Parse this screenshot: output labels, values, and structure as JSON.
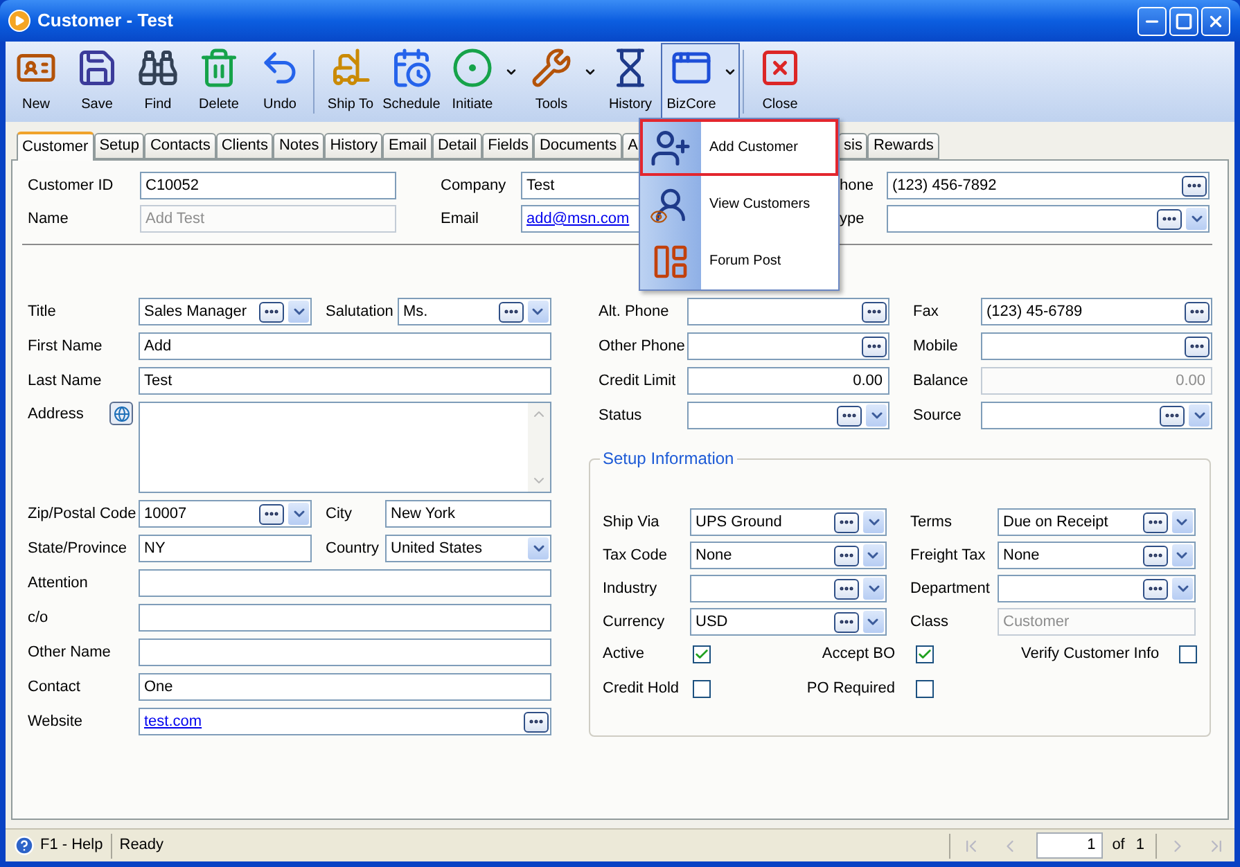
{
  "window": {
    "title": "Customer - Test"
  },
  "toolbar": {
    "groups": [
      {
        "items": [
          {
            "label": "New",
            "kind": "button",
            "pressed": false
          },
          {
            "label": "Save",
            "kind": "button",
            "pressed": false
          },
          {
            "label": "Find",
            "kind": "button",
            "pressed": false
          },
          {
            "label": "Delete",
            "kind": "button",
            "pressed": false
          },
          {
            "label": "Undo",
            "kind": "button",
            "pressed": false
          }
        ]
      },
      {
        "items": [
          {
            "label": "Ship To",
            "kind": "button",
            "pressed": false
          },
          {
            "label": "Schedule",
            "kind": "button",
            "pressed": false
          },
          {
            "label": "Initiate",
            "kind": "split",
            "pressed": false
          },
          {
            "label": "Tools",
            "kind": "split",
            "pressed": false
          },
          {
            "label": "History",
            "kind": "button",
            "pressed": false
          },
          {
            "label": "BizCore",
            "kind": "split",
            "pressed": true
          }
        ]
      },
      {
        "items": [
          {
            "label": "Close",
            "kind": "button",
            "pressed": false
          }
        ]
      }
    ]
  },
  "tabs": [
    {
      "label": "Customer",
      "selected": true
    },
    {
      "label": "Setup",
      "selected": false
    },
    {
      "label": "Contacts",
      "selected": false
    },
    {
      "label": "Clients",
      "selected": false
    },
    {
      "label": "Notes",
      "selected": false
    },
    {
      "label": "History",
      "selected": false
    },
    {
      "label": "Email",
      "selected": false
    },
    {
      "label": "Detail",
      "selected": false
    },
    {
      "label": "Fields",
      "selected": false
    },
    {
      "label": "Documents",
      "selected": false
    },
    {
      "label": "A",
      "selected": false
    },
    {
      "label": "sis",
      "selected": false
    },
    {
      "label": "Rewards",
      "selected": false
    }
  ],
  "menu": {
    "items": [
      {
        "label": "Add Customer",
        "selected": true
      },
      {
        "label": "View Customers",
        "selected": false
      },
      {
        "label": "Forum Post",
        "selected": false
      }
    ]
  },
  "header": {
    "rows": [
      [
        {
          "label": "Customer ID",
          "value": "C10052",
          "kind": "text",
          "disabled": false
        },
        {
          "label": "Company",
          "value": "Test",
          "kind": "text",
          "disabled": false
        },
        {
          "label": "hone",
          "value": "(123) 456-7892",
          "kind": "lookup",
          "disabled": false
        }
      ],
      [
        {
          "label": "Name",
          "value": "Add Test",
          "kind": "text",
          "disabled": true
        },
        {
          "label": "Email",
          "value": "add@msn.com",
          "kind": "link",
          "disabled": false
        },
        {
          "label": "ype",
          "kind": "combo",
          "disabled": false
        }
      ]
    ]
  },
  "contact": {
    "rows": [
      [
        {
          "label": "Title",
          "value": "Sales Manager",
          "kind": "combo",
          "disabled": false
        },
        {
          "label": "Salutation",
          "value": "Ms.",
          "kind": "combo",
          "disabled": false
        }
      ],
      [
        {
          "label": "First Name",
          "value": "Add",
          "kind": "text",
          "disabled": false
        }
      ],
      [
        {
          "label": "Last Name",
          "value": "Test",
          "kind": "text",
          "disabled": false
        }
      ],
      [
        {
          "label": "Address",
          "kind": "memo",
          "disabled": false
        }
      ],
      [
        {
          "label": "Zip/Postal Code",
          "value": "10007",
          "kind": "combo",
          "disabled": false
        },
        {
          "label": "City",
          "value": "New York",
          "kind": "text",
          "disabled": false
        }
      ],
      [
        {
          "label": "State/Province",
          "value": "NY",
          "kind": "text",
          "disabled": false
        },
        {
          "label": "Country",
          "value": "United States",
          "kind": "select",
          "disabled": false
        }
      ],
      [
        {
          "label": "Attention",
          "kind": "text",
          "disabled": false
        }
      ],
      [
        {
          "label": "c/o",
          "kind": "text",
          "disabled": false
        }
      ],
      [
        {
          "label": "Other Name",
          "kind": "text",
          "disabled": false
        }
      ],
      [
        {
          "label": "Contact",
          "value": "One",
          "kind": "text",
          "disabled": false
        }
      ],
      [
        {
          "label": "Website",
          "value": "test.com",
          "kind": "link_lookup",
          "disabled": false
        }
      ]
    ]
  },
  "phones": {
    "rows": [
      [
        {
          "label": "Alt. Phone",
          "kind": "lookup",
          "disabled": false
        },
        {
          "label": "Fax",
          "value": "(123) 45-6789",
          "kind": "lookup",
          "disabled": false
        }
      ],
      [
        {
          "label": "Other Phone",
          "kind": "lookup",
          "disabled": false
        },
        {
          "label": "Mobile",
          "kind": "lookup",
          "disabled": false
        }
      ],
      [
        {
          "label": "Credit Limit",
          "value": "0.00",
          "kind": "number",
          "disabled": false
        },
        {
          "label": "Balance",
          "value": "0.00",
          "kind": "number",
          "disabled": true
        }
      ],
      [
        {
          "label": "Status",
          "kind": "combo",
          "disabled": false
        },
        {
          "label": "Source",
          "kind": "combo",
          "disabled": false
        }
      ]
    ]
  },
  "setup": {
    "title": "Setup Information",
    "rows": [
      [
        {
          "label": "Ship Via",
          "value": "UPS Ground",
          "kind": "combo",
          "disabled": false
        },
        {
          "label": "Terms",
          "value": "Due on Receipt",
          "kind": "combo",
          "disabled": false
        }
      ],
      [
        {
          "label": "Tax Code",
          "value": "None",
          "kind": "combo",
          "disabled": false
        },
        {
          "label": "Freight Tax",
          "value": "None",
          "kind": "combo",
          "disabled": false
        }
      ],
      [
        {
          "label": "Industry",
          "kind": "combo",
          "disabled": false
        },
        {
          "label": "Department",
          "kind": "combo",
          "disabled": false
        }
      ],
      [
        {
          "label": "Currency",
          "value": "USD",
          "kind": "combo",
          "disabled": false
        },
        {
          "label": "Class",
          "value": "Customer",
          "kind": "text",
          "disabled": true
        }
      ]
    ],
    "checks": [
      [
        {
          "label": "Active",
          "checked": true
        },
        {
          "label": "Accept BO",
          "checked": true
        },
        {
          "label": "Verify Customer Info",
          "checked": false
        }
      ],
      [
        {
          "label": "Credit Hold",
          "checked": false
        },
        {
          "label": "PO Required",
          "checked": false
        }
      ]
    ]
  },
  "status_bar": {
    "help": "F1 - Help",
    "status": "Ready",
    "page": "1",
    "of": "of",
    "total": "1"
  }
}
